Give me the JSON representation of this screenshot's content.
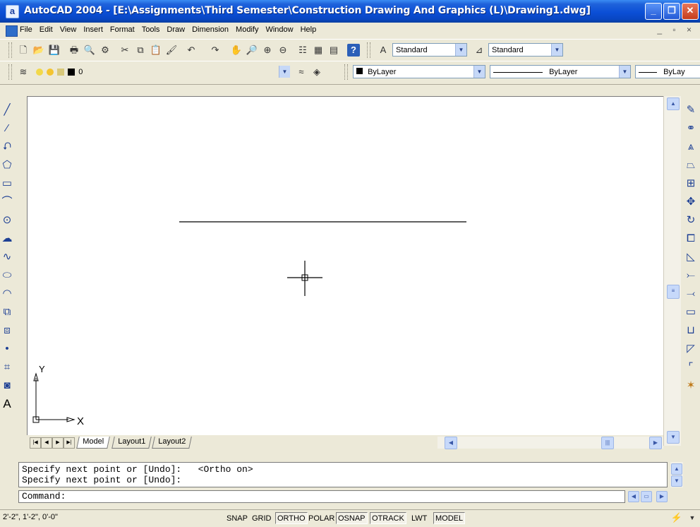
{
  "window": {
    "title": "AutoCAD 2004 - [E:\\Assignments\\Third Semester\\Construction Drawing And Graphics (L)\\Drawing1.dwg]",
    "app_icon_letter": "a"
  },
  "menu": {
    "items": [
      "File",
      "Edit",
      "View",
      "Insert",
      "Format",
      "Tools",
      "Draw",
      "Dimension",
      "Modify",
      "Window",
      "Help"
    ],
    "mdi_controls": "_ ▫ ×"
  },
  "toolbar_standard": {
    "text_style": "Standard",
    "dim_style": "Standard"
  },
  "toolbar_layers": {
    "current_layer": "0",
    "color": "ByLayer",
    "linetype": "ByLayer",
    "lineweight": "ByLay"
  },
  "drawing": {
    "ucs_x_label": "X",
    "ucs_y_label": "Y"
  },
  "layout_tabs": [
    "Model",
    "Layout1",
    "Layout2"
  ],
  "command_window": {
    "history": [
      "Specify next point or [Undo]:   <Ortho on>",
      "Specify next point or [Undo]:"
    ],
    "prompt": "Command:"
  },
  "status_bar": {
    "coordinates": "2'-2\", 1'-2\", 0'-0\"",
    "toggles": [
      {
        "label": "SNAP",
        "on": false
      },
      {
        "label": "GRID",
        "on": false
      },
      {
        "label": "ORTHO",
        "on": true
      },
      {
        "label": "POLAR",
        "on": false
      },
      {
        "label": "OSNAP",
        "on": true
      },
      {
        "label": "OTRACK",
        "on": true
      },
      {
        "label": "LWT",
        "on": false
      },
      {
        "label": "MODEL",
        "on": true
      }
    ]
  }
}
